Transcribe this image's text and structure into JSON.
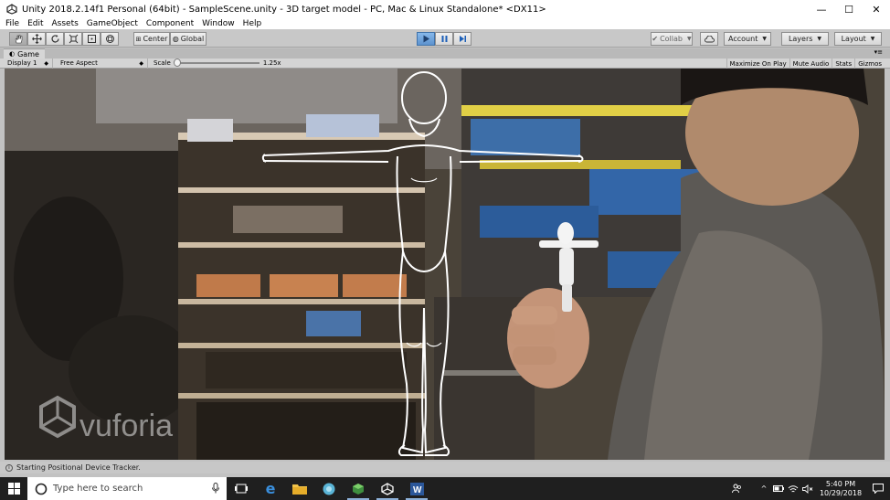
{
  "window": {
    "title": "Unity 2018.2.14f1 Personal (64bit) - SampleScene.unity - 3D target model - PC, Mac & Linux Standalone* <DX11>",
    "minimize": "—",
    "maximize": "☐",
    "close": "✕"
  },
  "menu": {
    "items": [
      "File",
      "Edit",
      "Assets",
      "GameObject",
      "Component",
      "Window",
      "Help"
    ]
  },
  "toolbar": {
    "pivot_label": "Center",
    "space_label": "Global",
    "collab_label": "Collab",
    "account_label": "Account",
    "layers_label": "Layers",
    "layout_label": "Layout"
  },
  "game_view": {
    "tab_label": "Game",
    "display_label": "Display 1",
    "aspect_label": "Free Aspect",
    "scale_label": "Scale",
    "scale_value": "1.25x",
    "options": [
      "Maximize On Play",
      "Mute Audio",
      "Stats",
      "Gizmos"
    ],
    "watermark": "vuforia"
  },
  "status": {
    "message": "Starting Positional Device Tracker."
  },
  "taskbar": {
    "search_placeholder": "Type here to search",
    "time": "5:40 PM",
    "date": "10/29/2018"
  },
  "colors": {
    "play_active": "#5d93cf",
    "taskbar": "#1f1f1f",
    "toolbar": "#c8c8c8"
  }
}
